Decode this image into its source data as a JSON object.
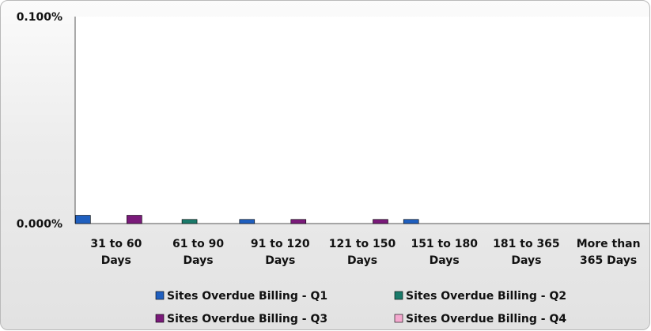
{
  "chart_data": {
    "type": "bar",
    "categories": [
      [
        "31 to 60",
        "Days"
      ],
      [
        "61 to 90",
        "Days"
      ],
      [
        "91 to 120",
        "Days"
      ],
      [
        "121 to 150",
        "Days"
      ],
      [
        "151 to 180",
        "Days"
      ],
      [
        "181 to 365",
        "Days"
      ],
      [
        "More than",
        "365 Days"
      ]
    ],
    "series": [
      {
        "name": "Sites Overdue Billing - Q1",
        "color": "#1f5fbf",
        "values": [
          0.004,
          0.0,
          0.002,
          0.0,
          0.002,
          0.0,
          0.0
        ]
      },
      {
        "name": "Sites Overdue Billing - Q2",
        "color": "#1a7a6a",
        "values": [
          0.0,
          0.002,
          0.0,
          0.0,
          0.0,
          0.0,
          0.0
        ]
      },
      {
        "name": "Sites Overdue Billing - Q3",
        "color": "#7a1a7a",
        "values": [
          0.004,
          0.0,
          0.002,
          0.002,
          0.0,
          0.0,
          0.0
        ]
      },
      {
        "name": "Sites Overdue Billing - Q4",
        "color": "#f4a9cf",
        "values": [
          0.0,
          0.0,
          0.0,
          0.0,
          0.0,
          0.0,
          0.0
        ]
      }
    ],
    "yticks": [
      "0.000%",
      "0.100%"
    ],
    "ylim": [
      0,
      0.1
    ],
    "grid": false,
    "legend_position": "bottom"
  }
}
